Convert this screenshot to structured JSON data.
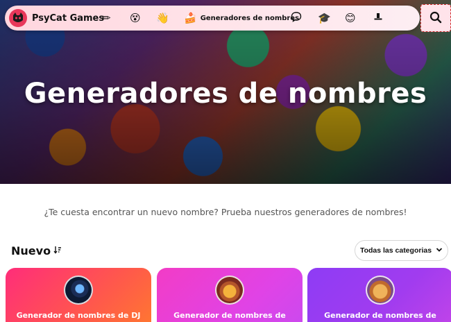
{
  "nav": {
    "brand": "PsyCat Games",
    "logo_icon": "cat-logo-icon",
    "generators_label": "Generadores de nombres",
    "icons": [
      "pencil-icon",
      "quiz-face-icon",
      "hand-icon",
      "generators-icon",
      "chat-bubble-icon",
      "graduation-cap-icon",
      "character-face-icon",
      "hat-icon"
    ],
    "search_icon": "search-icon"
  },
  "hero": {
    "title": "Generadores de nombres"
  },
  "intro": {
    "text": "¿Te cuesta encontrar un nuevo nombre? Prueba nuestros generadores de nombres!"
  },
  "section": {
    "title": "Nuevo",
    "sort_icon": "sort-descending-icon",
    "category_select": "Todas las categorias"
  },
  "cards": [
    {
      "title": "Generador de nombres de DJ",
      "image": "dj-avatar"
    },
    {
      "title": "Generador de nombres de castelos",
      "image": "castle-avatar"
    },
    {
      "title": "Generador de nombres de clanes de Clash of Clans",
      "image": "clash-avatar"
    }
  ],
  "colors": {
    "navbar": "#ffe2e8",
    "logo": "#e8375a",
    "card1": "#ff3d6a",
    "card2": "#e847d8",
    "card3": "#9b3cf2"
  }
}
